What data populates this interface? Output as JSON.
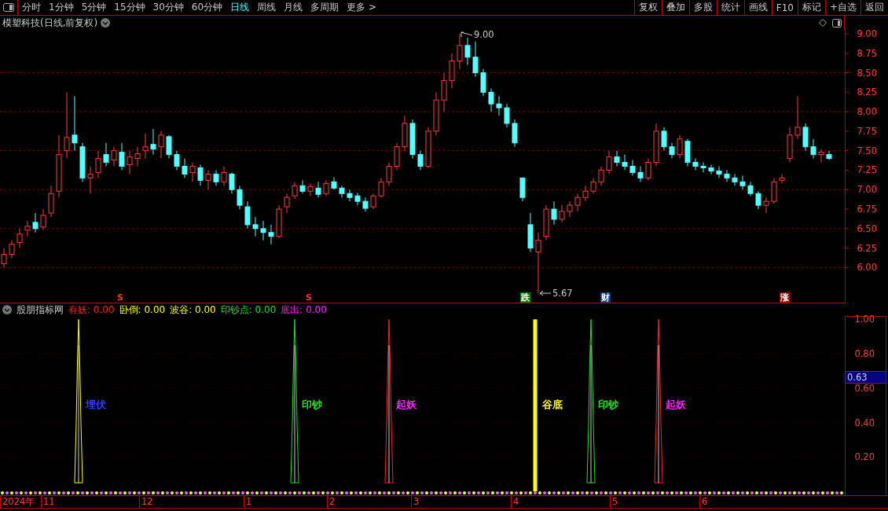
{
  "toolbar": {
    "periods": [
      {
        "label": "分时",
        "selected": false
      },
      {
        "label": "1分钟",
        "selected": false
      },
      {
        "label": "5分钟",
        "selected": false
      },
      {
        "label": "15分钟",
        "selected": false
      },
      {
        "label": "30分钟",
        "selected": false
      },
      {
        "label": "60分钟",
        "selected": false
      },
      {
        "label": "日线",
        "selected": true
      },
      {
        "label": "周线",
        "selected": false
      },
      {
        "label": "月线",
        "selected": false
      },
      {
        "label": "多周期",
        "selected": false
      }
    ],
    "more": "更多 >",
    "buttons": [
      "复权",
      "叠加",
      "多股",
      "统计",
      "画线",
      "F10",
      "标记",
      "+自选",
      "返回"
    ]
  },
  "chart": {
    "title": "模塑科技(日线,前复权)",
    "high_label": "9.00",
    "low_label": "5.67",
    "chart_data": {
      "type": "candlestick",
      "ylim": [
        5.55,
        9.05
      ],
      "grid": true,
      "yticks": [
        {
          "value": 9,
          "label": "9.00"
        },
        {
          "value": 8.75,
          "label": "8.75"
        },
        {
          "value": 8.5,
          "label": "8.50"
        },
        {
          "value": 8.25,
          "label": "8.25"
        },
        {
          "value": 8,
          "label": "8.00"
        },
        {
          "value": 7.75,
          "label": "7.75"
        },
        {
          "value": 7.5,
          "label": "7.50"
        },
        {
          "value": 7.25,
          "label": "7.25"
        },
        {
          "value": 7,
          "label": "7.00"
        },
        {
          "value": 6.75,
          "label": "6.75"
        },
        {
          "value": 6.5,
          "label": "6.50"
        },
        {
          "value": 6.25,
          "label": "6.25"
        },
        {
          "value": 6,
          "label": "6.00"
        }
      ],
      "ohlc": [
        [
          6.05,
          6.25,
          6.0,
          6.17
        ],
        [
          6.17,
          6.35,
          6.12,
          6.3
        ],
        [
          6.32,
          6.5,
          6.25,
          6.43
        ],
        [
          6.48,
          6.6,
          6.4,
          6.53
        ],
        [
          6.58,
          6.7,
          6.45,
          6.5
        ],
        [
          6.52,
          6.75,
          6.48,
          6.67
        ],
        [
          6.7,
          7.05,
          6.65,
          6.95
        ],
        [
          6.98,
          7.7,
          6.9,
          7.45
        ],
        [
          7.5,
          8.25,
          7.4,
          7.67
        ],
        [
          7.7,
          8.2,
          7.5,
          7.6
        ],
        [
          7.55,
          7.6,
          7.1,
          7.15
        ],
        [
          7.15,
          7.3,
          6.95,
          7.2
        ],
        [
          7.22,
          7.5,
          7.15,
          7.4
        ],
        [
          7.45,
          7.6,
          7.3,
          7.35
        ],
        [
          7.38,
          7.55,
          7.3,
          7.5
        ],
        [
          7.48,
          7.6,
          7.25,
          7.3
        ],
        [
          7.32,
          7.5,
          7.2,
          7.42
        ],
        [
          7.4,
          7.55,
          7.3,
          7.46
        ],
        [
          7.5,
          7.72,
          7.4,
          7.55
        ],
        [
          7.58,
          7.78,
          7.45,
          7.52
        ],
        [
          7.55,
          7.75,
          7.4,
          7.7
        ],
        [
          7.68,
          7.7,
          7.4,
          7.45
        ],
        [
          7.45,
          7.5,
          7.25,
          7.3
        ],
        [
          7.3,
          7.4,
          7.15,
          7.2
        ],
        [
          7.22,
          7.35,
          7.1,
          7.3
        ],
        [
          7.28,
          7.32,
          7.05,
          7.12
        ],
        [
          7.12,
          7.25,
          7.0,
          7.2
        ],
        [
          7.2,
          7.25,
          7.05,
          7.1
        ],
        [
          7.1,
          7.3,
          7.05,
          7.22
        ],
        [
          7.2,
          7.22,
          6.95,
          7.0
        ],
        [
          7.0,
          7.05,
          6.75,
          6.8
        ],
        [
          6.78,
          6.85,
          6.5,
          6.55
        ],
        [
          6.55,
          6.65,
          6.4,
          6.5
        ],
        [
          6.5,
          6.6,
          6.35,
          6.45
        ],
        [
          6.45,
          6.55,
          6.3,
          6.4
        ],
        [
          6.4,
          6.8,
          6.38,
          6.75
        ],
        [
          6.78,
          6.95,
          6.7,
          6.9
        ],
        [
          6.92,
          7.1,
          6.88,
          7.05
        ],
        [
          7.05,
          7.12,
          6.95,
          6.98
        ],
        [
          6.98,
          7.08,
          6.92,
          7.04
        ],
        [
          7.02,
          7.1,
          6.9,
          6.94
        ],
        [
          6.95,
          7.12,
          6.92,
          7.08
        ],
        [
          7.1,
          7.16,
          7.0,
          7.02
        ],
        [
          7.02,
          7.05,
          6.9,
          6.95
        ],
        [
          6.95,
          7.0,
          6.85,
          6.9
        ],
        [
          6.92,
          6.96,
          6.8,
          6.85
        ],
        [
          6.85,
          6.9,
          6.72,
          6.76
        ],
        [
          6.78,
          6.95,
          6.75,
          6.92
        ],
        [
          6.92,
          7.15,
          6.9,
          7.1
        ],
        [
          7.1,
          7.35,
          7.05,
          7.3
        ],
        [
          7.3,
          7.6,
          7.25,
          7.55
        ],
        [
          7.55,
          7.95,
          7.5,
          7.85
        ],
        [
          7.85,
          7.9,
          7.4,
          7.45
        ],
        [
          7.45,
          7.5,
          7.25,
          7.3
        ],
        [
          7.3,
          7.8,
          7.28,
          7.75
        ],
        [
          7.75,
          8.25,
          7.7,
          8.15
        ],
        [
          8.15,
          8.5,
          8.0,
          8.4
        ],
        [
          8.4,
          8.75,
          8.3,
          8.65
        ],
        [
          8.65,
          9.0,
          8.55,
          8.85
        ],
        [
          8.85,
          8.95,
          8.6,
          8.7
        ],
        [
          8.7,
          8.9,
          8.45,
          8.5
        ],
        [
          8.5,
          8.55,
          8.2,
          8.25
        ],
        [
          8.25,
          8.3,
          8.0,
          8.1
        ],
        [
          8.1,
          8.2,
          7.95,
          8.05
        ],
        [
          8.05,
          8.1,
          7.8,
          7.85
        ],
        [
          7.85,
          7.9,
          7.55,
          7.6
        ],
        [
          7.15,
          7.15,
          6.85,
          6.9
        ],
        [
          6.55,
          6.7,
          6.2,
          6.25
        ],
        [
          6.2,
          6.45,
          5.67,
          6.35
        ],
        [
          6.4,
          6.8,
          6.35,
          6.75
        ],
        [
          6.75,
          6.85,
          6.55,
          6.62
        ],
        [
          6.62,
          6.8,
          6.58,
          6.72
        ],
        [
          6.72,
          6.85,
          6.65,
          6.8
        ],
        [
          6.8,
          6.95,
          6.72,
          6.9
        ],
        [
          6.9,
          7.05,
          6.85,
          6.98
        ],
        [
          6.98,
          7.15,
          6.95,
          7.1
        ],
        [
          7.1,
          7.3,
          7.05,
          7.25
        ],
        [
          7.25,
          7.5,
          7.2,
          7.42
        ],
        [
          7.42,
          7.5,
          7.3,
          7.35
        ],
        [
          7.35,
          7.45,
          7.25,
          7.3
        ],
        [
          7.3,
          7.38,
          7.18,
          7.22
        ],
        [
          7.22,
          7.3,
          7.1,
          7.15
        ],
        [
          7.15,
          7.4,
          7.12,
          7.35
        ],
        [
          7.35,
          7.85,
          7.3,
          7.75
        ],
        [
          7.75,
          7.8,
          7.5,
          7.55
        ],
        [
          7.55,
          7.6,
          7.4,
          7.45
        ],
        [
          7.45,
          7.7,
          7.4,
          7.65
        ],
        [
          7.62,
          7.65,
          7.3,
          7.35
        ],
        [
          7.35,
          7.4,
          7.25,
          7.3
        ],
        [
          7.3,
          7.35,
          7.22,
          7.28
        ],
        [
          7.28,
          7.32,
          7.2,
          7.24
        ],
        [
          7.24,
          7.3,
          7.15,
          7.2
        ],
        [
          7.2,
          7.25,
          7.1,
          7.15
        ],
        [
          7.15,
          7.2,
          7.05,
          7.1
        ],
        [
          7.1,
          7.18,
          7.0,
          7.05
        ],
        [
          7.05,
          7.1,
          6.92,
          6.95
        ],
        [
          6.95,
          6.98,
          6.75,
          6.8
        ],
        [
          6.8,
          6.9,
          6.7,
          6.85
        ],
        [
          6.85,
          7.15,
          6.82,
          7.1
        ],
        [
          7.12,
          7.2,
          7.08,
          7.15
        ],
        [
          7.4,
          7.8,
          7.35,
          7.7
        ],
        [
          7.7,
          8.2,
          7.65,
          7.8
        ],
        [
          7.8,
          7.85,
          7.5,
          7.55
        ],
        [
          7.55,
          7.65,
          7.4,
          7.45
        ],
        [
          7.45,
          7.52,
          7.35,
          7.48
        ],
        [
          7.45,
          7.5,
          7.38,
          7.4
        ]
      ]
    },
    "signals": [
      {
        "label": "S",
        "kind": "letter",
        "color": "#ff3030"
      },
      {
        "label": "S",
        "kind": "letter",
        "color": "#ff3030"
      },
      {
        "label": "跌",
        "kind": "badge",
        "color": "#008000"
      },
      {
        "label": "财",
        "kind": "badge",
        "color": "#0a3a7a"
      },
      {
        "label": "涨",
        "kind": "badge",
        "color": "#a00000"
      }
    ]
  },
  "indicator": {
    "name": "股朋指标网",
    "legend": [
      {
        "label": "有妖:",
        "value": "0.00",
        "color": "#ff2020"
      },
      {
        "label": "卧倒:",
        "value": "0.00",
        "color": "#ffff00"
      },
      {
        "label": "波谷:",
        "value": "0.00",
        "color": "#ffff00"
      },
      {
        "label": "印钞点:",
        "value": "0.00",
        "color": "#20e020"
      },
      {
        "label": "底出:",
        "value": "0.00",
        "color": "#ff20ff"
      }
    ],
    "yticks": [
      "1.00",
      "0.80",
      "0.60",
      "0.40",
      "0.20"
    ],
    "current_value": "0.63",
    "signals": [
      {
        "label": "埋伏",
        "kind": "ambush",
        "color": "#3040ff"
      },
      {
        "label": "印钞",
        "kind": "print",
        "color": "#20e020"
      },
      {
        "label": "起妖",
        "kind": "demon",
        "color": "#ff20ff"
      },
      {
        "label": "谷底",
        "kind": "valley",
        "color": "#ffff00"
      },
      {
        "label": "印钞",
        "kind": "print",
        "color": "#20e020"
      },
      {
        "label": "起妖",
        "kind": "demon",
        "color": "#ff20ff"
      }
    ]
  },
  "x_axis": [
    "2024年",
    "11",
    "12",
    "1",
    "2",
    "3",
    "4",
    "5",
    "6"
  ]
}
